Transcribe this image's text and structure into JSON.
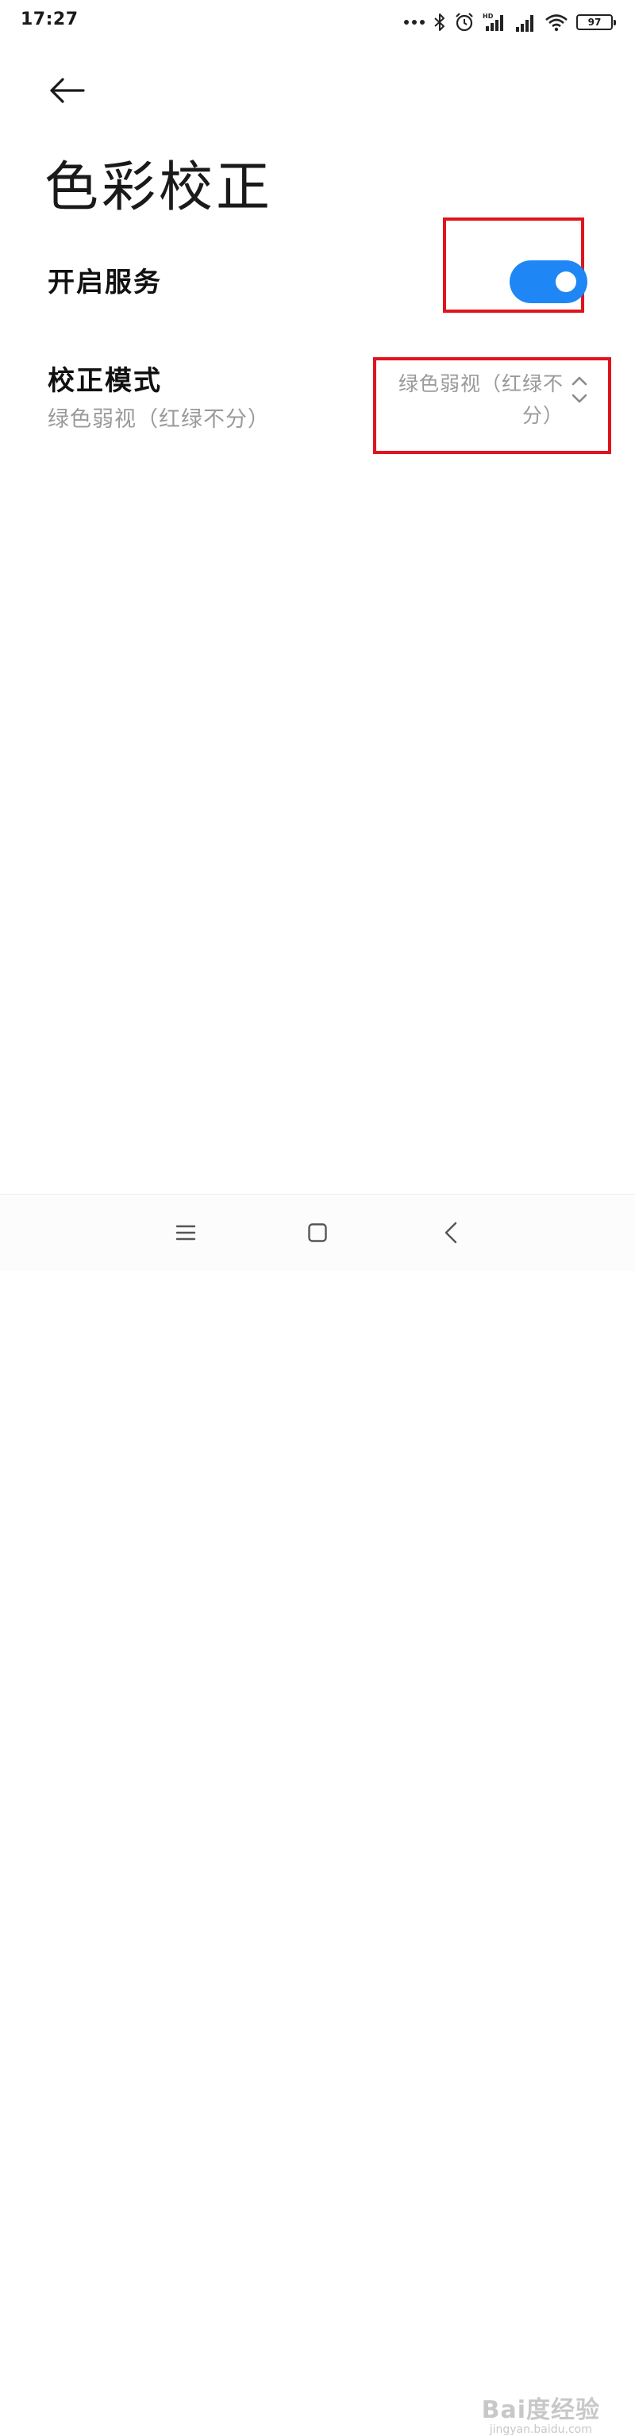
{
  "status_bar": {
    "time": "17:27",
    "network_label": "HD",
    "battery": "97",
    "icons": [
      "more-dots-icon",
      "bluetooth-icon",
      "alarm-icon",
      "signal-hd-icon",
      "signal-icon",
      "wifi-icon",
      "battery-icon"
    ]
  },
  "header": {
    "back_icon": "back-arrow-icon",
    "title": "色彩校正"
  },
  "service": {
    "label": "开启服务",
    "enabled": true,
    "accent_color": "#1e87f5"
  },
  "correction_mode": {
    "label": "校正模式",
    "summary": "绿色弱视（红绿不分）",
    "value_line1": "绿色弱视（红绿不",
    "value_line2": "分）",
    "icon": "up-down-chevron-icon"
  },
  "highlight_color": "#e0141e",
  "nav_bar": {
    "icons": [
      "menu-icon",
      "home-icon",
      "back-icon"
    ]
  },
  "watermark": {
    "text": "Bai度经验",
    "sub": "jingyan.baidu.com"
  }
}
